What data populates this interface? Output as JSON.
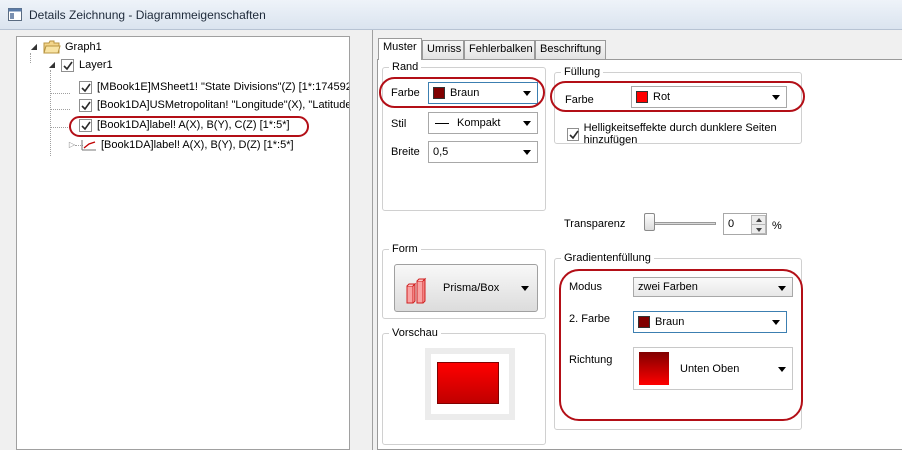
{
  "window": {
    "title": "Details Zeichnung - Diagrammeigenschaften"
  },
  "tree": {
    "graph": "Graph1",
    "layer": "Layer1",
    "plots": [
      "[MBook1E]MSheet1! \"State Divisions\"(Z) [1*:174592",
      "[Book1DA]USMetropolitan! \"Longitude\"(X), \"Latitude",
      "[Book1DA]label! A(X), B(Y), C(Z) [1*:5*]",
      "[Book1DA]label! A(X), B(Y), D(Z) [1*:5*]"
    ]
  },
  "tabs": [
    "Muster",
    "Umriss",
    "Fehlerbalken",
    "Beschriftung"
  ],
  "rand": {
    "title": "Rand",
    "farbe_label": "Farbe",
    "farbe_value": "Braun",
    "stil_label": "Stil",
    "stil_value": "Kompakt",
    "breite_label": "Breite",
    "breite_value": "0,5"
  },
  "fuellung": {
    "title": "Füllung",
    "farbe_label": "Farbe",
    "farbe_value": "Rot",
    "checkbox_label": "Helligkeitseffekte durch dunklere Seiten hinzufügen",
    "checkbox_checked": true
  },
  "transparenz": {
    "label": "Transparenz",
    "value": "0",
    "unit": "%",
    "level": 0
  },
  "form": {
    "title": "Form",
    "value": "Prisma/Box"
  },
  "vorschau": {
    "title": "Vorschau"
  },
  "gradient": {
    "title": "Gradientenfüllung",
    "modus_label": "Modus",
    "modus_value": "zwei Farben",
    "farbe2_label": "2. Farbe",
    "farbe2_value": "Braun",
    "richtung_label": "Richtung",
    "richtung_value": "Unten Oben"
  },
  "colors": {
    "braun": "#800000",
    "rot": "#ff0000",
    "highlight": "#b30f17"
  }
}
